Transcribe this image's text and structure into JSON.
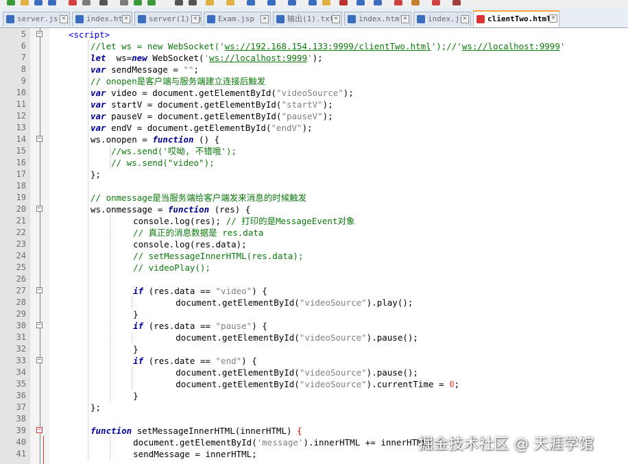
{
  "tabs": [
    {
      "label": "server.js",
      "active": false
    },
    {
      "label": "index.html",
      "active": false
    },
    {
      "label": "server(1).js",
      "active": false
    },
    {
      "label": "Exam.jsp",
      "active": false
    },
    {
      "label": "输出(1).txt",
      "active": false
    },
    {
      "label": "index.html",
      "active": false
    },
    {
      "label": "index.js",
      "active": false
    },
    {
      "label": "clientTwo.html",
      "active": true
    }
  ],
  "tab_close_glyph": "✕",
  "watermark": "掘金技术社区 @ 天涯学馆",
  "colors": {
    "active_tab_accent": "#f6a53a",
    "keyword": "#00009a",
    "comment": "#0a7a0a",
    "string": "#808080",
    "tag": "#0000ff",
    "number": "#ff4040"
  },
  "lines": [
    {
      "n": "5",
      "fold": "minus",
      "segs": [
        [
          "tag",
          "<script>"
        ]
      ]
    },
    {
      "n": "6",
      "segs": [
        [
          "cm",
          "//let ws = new WebSocket('"
        ],
        [
          "url",
          "ws://192.168.154.133:9999/clientTwo.html"
        ],
        [
          "cm",
          "');//'"
        ],
        [
          "url",
          "ws://localhost:9999"
        ],
        [
          "cm",
          "'"
        ]
      ]
    },
    {
      "n": "7",
      "segs": [
        [
          "kw",
          "let"
        ],
        [
          "",
          "  ws="
        ],
        [
          "kw",
          "new"
        ],
        [
          "",
          " WebSocket("
        ],
        [
          "str",
          "'"
        ],
        [
          "url",
          "ws://localhost:9999"
        ],
        [
          "str",
          "'"
        ],
        [
          "",
          ");"
        ]
      ]
    },
    {
      "n": "8",
      "segs": [
        [
          "kw",
          "var"
        ],
        [
          "",
          " sendMessage = "
        ],
        [
          "str",
          "\"\""
        ],
        [
          "",
          ";"
        ]
      ]
    },
    {
      "n": "9",
      "segs": [
        [
          "cm",
          "// onopen是客户端与服务端建立连接后触发"
        ]
      ]
    },
    {
      "n": "10",
      "segs": [
        [
          "kw",
          "var"
        ],
        [
          "",
          " video = document.getElementById("
        ],
        [
          "str",
          "\"videoSource\""
        ],
        [
          "",
          ");"
        ]
      ]
    },
    {
      "n": "11",
      "segs": [
        [
          "kw",
          "var"
        ],
        [
          "",
          " startV = document.getElementById("
        ],
        [
          "str",
          "\"startV\""
        ],
        [
          "",
          ");"
        ]
      ]
    },
    {
      "n": "12",
      "segs": [
        [
          "kw",
          "var"
        ],
        [
          "",
          " pauseV = document.getElementById("
        ],
        [
          "str",
          "\"pauseV\""
        ],
        [
          "",
          ");"
        ]
      ]
    },
    {
      "n": "13",
      "segs": [
        [
          "kw",
          "var"
        ],
        [
          "",
          " endV = document.getElementById("
        ],
        [
          "str",
          "\"endV\""
        ],
        [
          "",
          ");"
        ]
      ]
    },
    {
      "n": "14",
      "fold": "minus",
      "segs": [
        [
          "",
          "ws.onopen = "
        ],
        [
          "kw",
          "function"
        ],
        [
          "",
          " () {"
        ]
      ]
    },
    {
      "n": "15",
      "segs": [
        [
          "cm",
          "    //ws.send('哎呦, 不错哦');"
        ]
      ]
    },
    {
      "n": "16",
      "segs": [
        [
          "cm",
          "    // ws.send(\"video\");"
        ]
      ]
    },
    {
      "n": "17",
      "segs": [
        [
          "",
          "};"
        ]
      ]
    },
    {
      "n": "18",
      "segs": []
    },
    {
      "n": "19",
      "segs": [
        [
          "cm",
          "// onmessage是当服务端给客户端发来消息的时候触发"
        ]
      ]
    },
    {
      "n": "20",
      "fold": "minus",
      "segs": [
        [
          "",
          "ws.onmessage = "
        ],
        [
          "kw",
          "function"
        ],
        [
          "",
          " (res) {"
        ]
      ]
    },
    {
      "n": "21",
      "segs": [
        [
          "",
          "    console.log(res); "
        ],
        [
          "cm",
          "// 打印的是MessageEvent对象"
        ]
      ]
    },
    {
      "n": "22",
      "segs": [
        [
          "cm",
          "    // 真正的消息数据是 res.data"
        ]
      ]
    },
    {
      "n": "23",
      "segs": [
        [
          "",
          "    console.log(res.data);"
        ]
      ]
    },
    {
      "n": "24",
      "segs": [
        [
          "cm",
          "    // setMessageInnerHTML(res.data);"
        ]
      ]
    },
    {
      "n": "25",
      "segs": [
        [
          "cm",
          "    // videoPlay();"
        ]
      ]
    },
    {
      "n": "26",
      "segs": []
    },
    {
      "n": "27",
      "fold": "minus",
      "segs": [
        [
          "",
          "    "
        ],
        [
          "kw",
          "if"
        ],
        [
          "",
          " (res.data == "
        ],
        [
          "str",
          "\"video\""
        ],
        [
          "",
          ") {"
        ]
      ]
    },
    {
      "n": "28",
      "segs": [
        [
          "",
          "        document.getElementById("
        ],
        [
          "str",
          "\"videoSource\""
        ],
        [
          "",
          ").play();"
        ]
      ]
    },
    {
      "n": "29",
      "segs": [
        [
          "",
          "    }"
        ]
      ]
    },
    {
      "n": "30",
      "fold": "minus",
      "segs": [
        [
          "",
          "    "
        ],
        [
          "kw",
          "if"
        ],
        [
          "",
          " (res.data == "
        ],
        [
          "str",
          "\"pause\""
        ],
        [
          "",
          ") {"
        ]
      ]
    },
    {
      "n": "31",
      "segs": [
        [
          "",
          "        document.getElementById("
        ],
        [
          "str",
          "\"videoSource\""
        ],
        [
          "",
          ").pause();"
        ]
      ]
    },
    {
      "n": "32",
      "segs": [
        [
          "",
          "    }"
        ]
      ]
    },
    {
      "n": "33",
      "fold": "minus",
      "segs": [
        [
          "",
          "    "
        ],
        [
          "kw",
          "if"
        ],
        [
          "",
          " (res.date == "
        ],
        [
          "str",
          "\"end\""
        ],
        [
          "",
          ") {"
        ]
      ]
    },
    {
      "n": "34",
      "segs": [
        [
          "",
          "        document.getElementById("
        ],
        [
          "str",
          "\"videoSource\""
        ],
        [
          "",
          ").pause();"
        ]
      ]
    },
    {
      "n": "35",
      "segs": [
        [
          "",
          "        document.getElementById("
        ],
        [
          "str",
          "\"videoSource\""
        ],
        [
          "",
          ").currentTime = "
        ],
        [
          "num",
          "0"
        ],
        [
          "",
          ";"
        ]
      ]
    },
    {
      "n": "36",
      "segs": [
        [
          "",
          "    }"
        ]
      ]
    },
    {
      "n": "37",
      "segs": [
        [
          "",
          "};"
        ]
      ]
    },
    {
      "n": "38",
      "segs": []
    },
    {
      "n": "39",
      "fold": "minus-red",
      "segs": [
        [
          "kw",
          "function"
        ],
        [
          "",
          " setMessageInnerHTML(innerHTML) "
        ],
        [
          "red",
          "{"
        ]
      ]
    },
    {
      "n": "40",
      "segs": [
        [
          "",
          "    document.getElementById("
        ],
        [
          "str",
          "'message'"
        ],
        [
          "",
          ").innerHTML += innerHTML;"
        ]
      ]
    },
    {
      "n": "41",
      "segs": [
        [
          "",
          "    sendMessage = innerHTML;"
        ]
      ]
    }
  ]
}
